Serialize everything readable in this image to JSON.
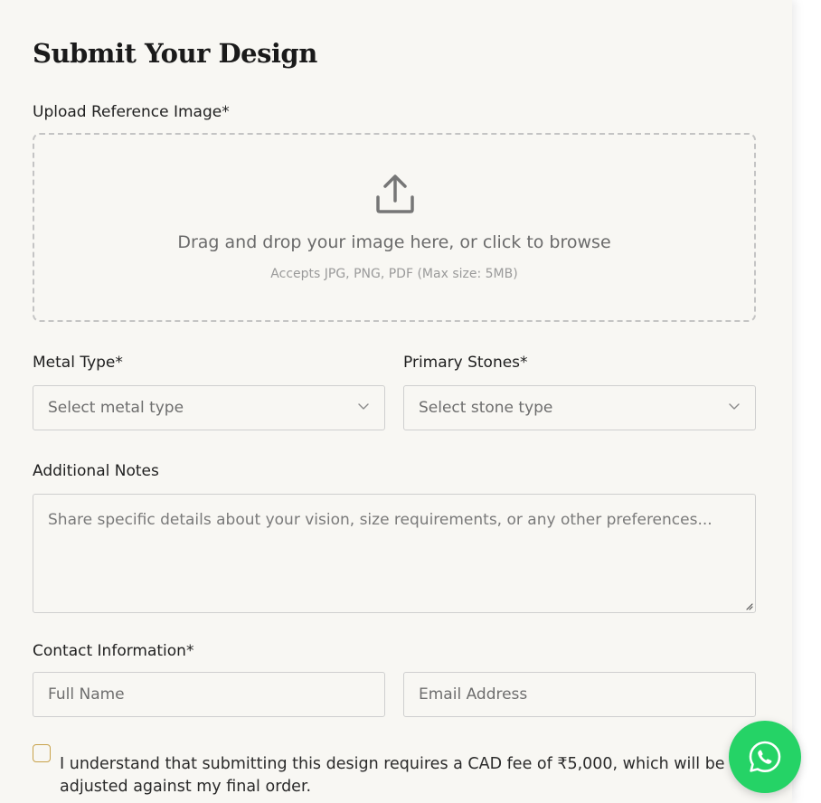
{
  "form": {
    "title": "Submit Your Design",
    "upload": {
      "label": "Upload Reference Image*",
      "main_text": "Drag and drop your image here, or click to browse",
      "sub_text": "Accepts JPG, PNG, PDF (Max size: 5MB)",
      "icon": "upload-icon"
    },
    "metal": {
      "label": "Metal Type*",
      "placeholder": "Select metal type"
    },
    "stones": {
      "label": "Primary Stones*",
      "placeholder": "Select stone type"
    },
    "notes": {
      "label": "Additional Notes",
      "placeholder": "Share specific details about your vision, size requirements, or any other preferences..."
    },
    "contact": {
      "label": "Contact Information*",
      "name_placeholder": "Full Name",
      "email_placeholder": "Email Address"
    },
    "consent": {
      "text": "I understand that submitting this design requires a CAD fee of ₹5,000, which will be adjusted against my final order.",
      "checked": false
    }
  },
  "whatsapp": {
    "icon": "whatsapp-icon",
    "color": "#25d366"
  },
  "colors": {
    "background": "#f8f7f3",
    "checkbox_border": "#c8a24a"
  }
}
